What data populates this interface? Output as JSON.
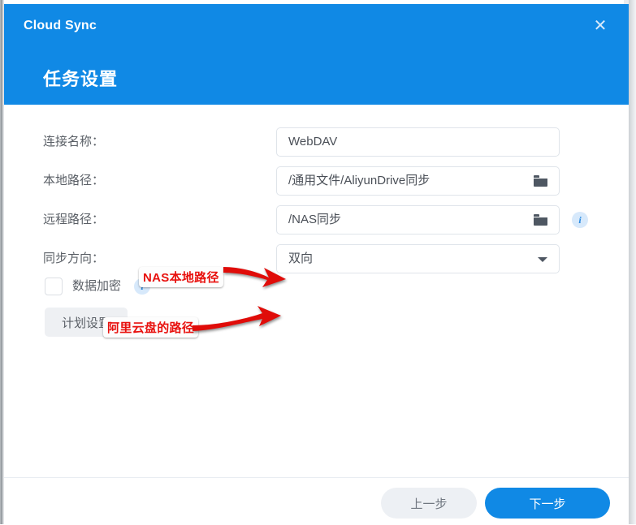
{
  "window": {
    "app_title": "Cloud Sync",
    "close_icon": "close-icon",
    "step_title": "任务设置"
  },
  "form": {
    "rows": [
      {
        "label": "连接名称：",
        "value": "WebDAV",
        "type": "text",
        "has_folder_icon": false,
        "has_info_icon": false
      },
      {
        "label": "本地路径：",
        "value": "/通用文件/AliyunDrive同步",
        "type": "path",
        "has_folder_icon": true,
        "has_info_icon": false
      },
      {
        "label": "远程路径：",
        "value": "/NAS同步",
        "type": "path",
        "has_folder_icon": true,
        "has_info_icon": true
      },
      {
        "label": "同步方向：",
        "value": "双向",
        "type": "select",
        "has_folder_icon": false,
        "has_info_icon": false
      }
    ],
    "encryption": {
      "label": "数据加密",
      "checked": false,
      "info_icon": "info-icon"
    },
    "schedule_button": "计划设置"
  },
  "footer": {
    "prev_label": "上一步",
    "next_label": "下一步"
  },
  "annotations": [
    {
      "text": "NAS本地路径",
      "target": "local-path-field"
    },
    {
      "text": "阿里云盘的路径",
      "target": "remote-path-field"
    }
  ],
  "colors": {
    "header_blue": "#1089e5",
    "primary_button": "#1089e5",
    "annotation_red": "#e8110e",
    "label_gray": "#5a5f66",
    "field_border": "#dfe4ea",
    "info_icon_bg": "#d7e9fb"
  }
}
